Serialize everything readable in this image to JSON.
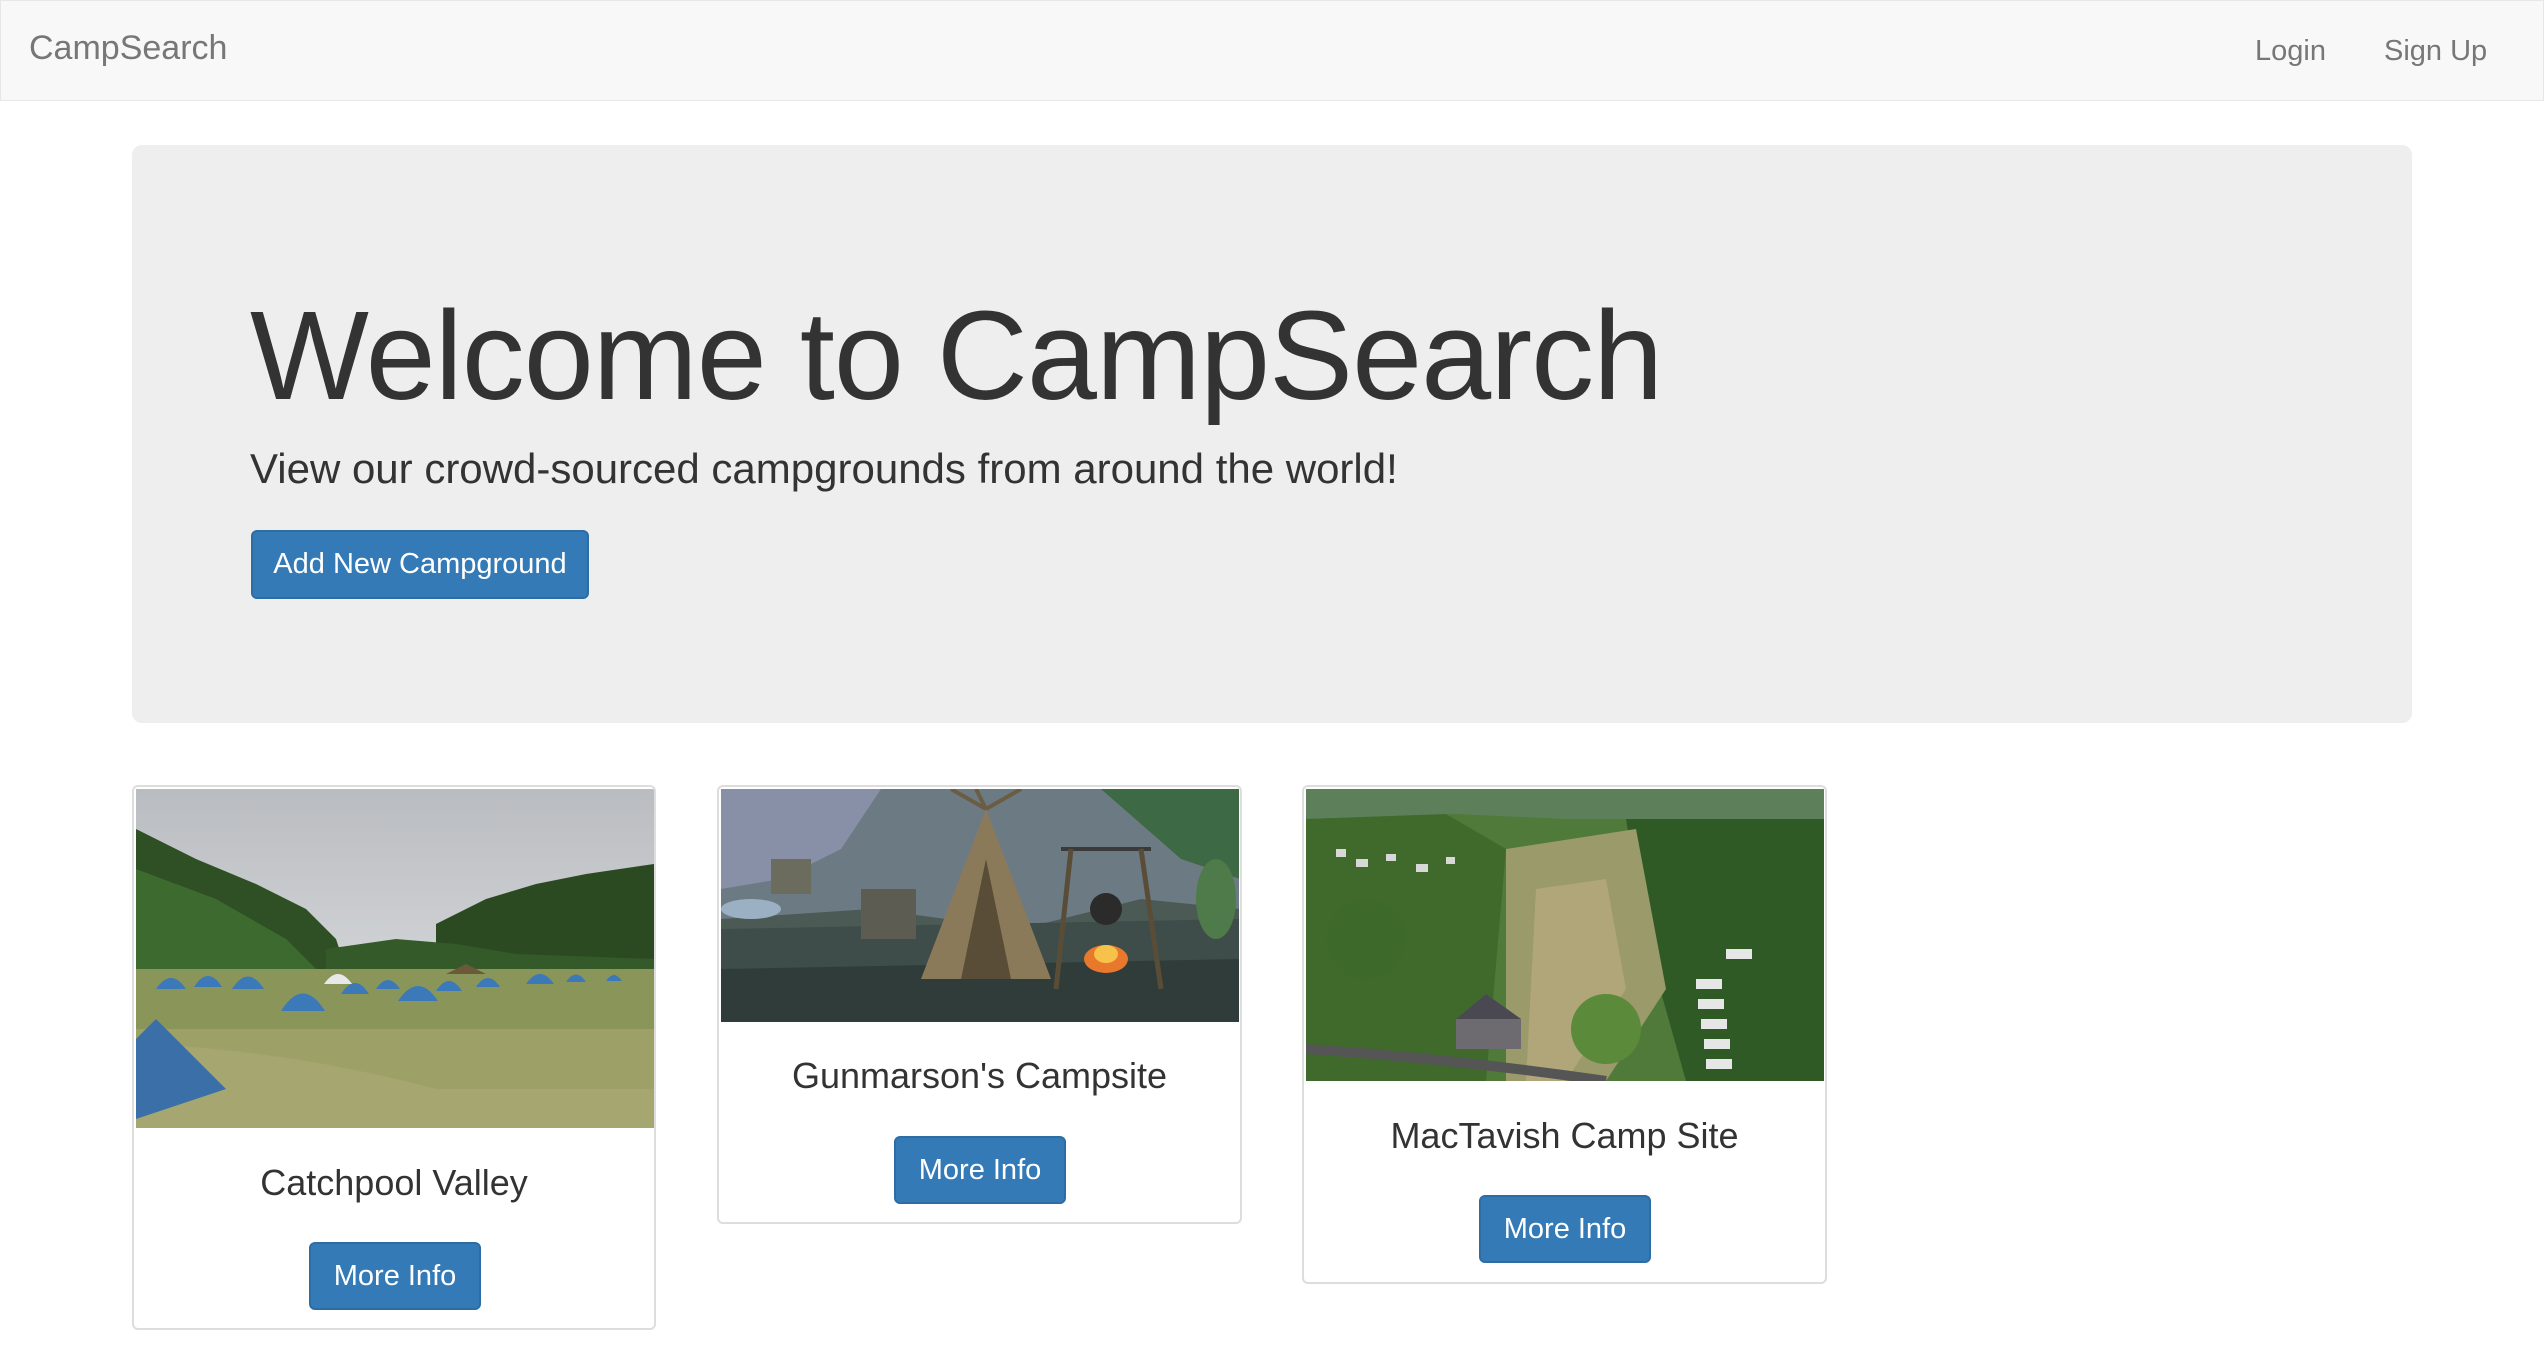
{
  "navbar": {
    "brand": "CampSearch",
    "login": "Login",
    "signup": "Sign Up"
  },
  "jumbotron": {
    "title": "Welcome to CampSearch",
    "subtitle": "View our crowd-sourced campgrounds from around the world!",
    "add_button": "Add New Campground"
  },
  "campgrounds": [
    {
      "name": "Catchpool Valley",
      "button": "More Info",
      "image": "tents-on-grass-photo"
    },
    {
      "name": "Gunmarson's Campsite",
      "button": "More Info",
      "image": "game-campfire-scene"
    },
    {
      "name": "MacTavish Camp Site",
      "button": "More Info",
      "image": "aerial-valley-photo"
    }
  ],
  "colors": {
    "primary": "#337ab7",
    "jumbotron_bg": "#eeeeee",
    "navbar_bg": "#f8f8f8"
  }
}
